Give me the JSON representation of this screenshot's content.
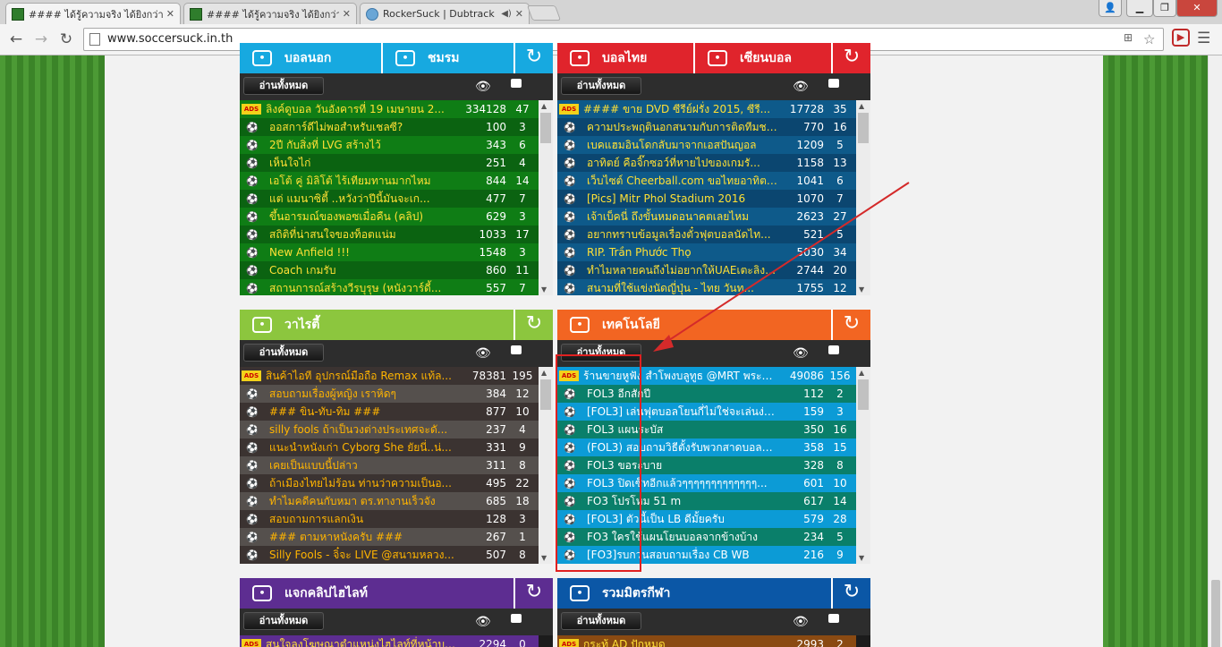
{
  "browser": {
    "tabs": [
      {
        "title": "#### ได้รู้ความจริง ได้ยิงกว่า",
        "icon": "soccersuck-favicon",
        "active": true
      },
      {
        "title": "#### ได้รู้ความจริง ได้ยิงกว่า",
        "icon": "soccersuck-favicon",
        "active": false
      },
      {
        "title": "RockerSuck | Dubtrack",
        "icon": "dubtrack-favicon",
        "active": false
      }
    ],
    "url": "www.soccersuck.in.th",
    "colors": {
      "close": "#c9463d",
      "tabbar": "#d4d4d4"
    }
  },
  "panels": [
    {
      "id": "football-foreign",
      "headers": [
        {
          "label": "บอลนอก",
          "icon": "runner-icon",
          "color": "#17a9e0",
          "w": 158
        },
        {
          "label": "ชมรม",
          "icon": "masks-icon",
          "color": "#17a9e0",
          "w": 148
        }
      ],
      "read_all": "อ่านทั้งหมด",
      "text_color": "#ffe035",
      "row_colors": [
        "#0f7d15",
        "#0b6311"
      ],
      "rows": [
        {
          "ads": true,
          "title": "ลิงค์ดูบอล วันอังคารที่ 19 เมษายน 2...",
          "views": "334128",
          "comments": "47"
        },
        {
          "ads": false,
          "title": "ออสการ์ดีไม่พอสำหรับเชลซี?",
          "views": "100",
          "comments": "3"
        },
        {
          "ads": false,
          "title": "2ปี กับสิ่งที่ LVG สร้างไว้",
          "views": "343",
          "comments": "6"
        },
        {
          "ads": false,
          "title": "เห็นใจไก่",
          "views": "251",
          "comments": "4"
        },
        {
          "ads": false,
          "title": "เอโต้ คู่ มิลิโต้ ไร้เทียมทานมากไหม",
          "views": "844",
          "comments": "14"
        },
        {
          "ads": false,
          "title": "แต่ แมนาซิตี้ ..หวังว่าปีนี้มันจะเก...",
          "views": "477",
          "comments": "7"
        },
        {
          "ads": false,
          "title": "ขึ้นอารมณ์ของพอซเมื่อคืน (คลิป)",
          "views": "629",
          "comments": "3"
        },
        {
          "ads": false,
          "title": "สถิติที่น่าสนใจของท็อตแน่ม",
          "views": "1033",
          "comments": "17"
        },
        {
          "ads": false,
          "title": "New Anfield !!!",
          "views": "1548",
          "comments": "3"
        },
        {
          "ads": false,
          "title": "Coach เกมรับ",
          "views": "860",
          "comments": "11"
        },
        {
          "ads": false,
          "title": "สถานการณ์สร้างวีรบุรุษ (หนังวาร์ดี้...",
          "views": "557",
          "comments": "7"
        }
      ]
    },
    {
      "id": "football-thai",
      "headers": [
        {
          "label": "บอลไทย",
          "icon": "kicker-icon",
          "color": "#e0242c",
          "w": 152
        },
        {
          "label": "เซียนบอล",
          "icon": "player-icon",
          "color": "#e0242c",
          "w": 154
        }
      ],
      "read_all": "อ่านทั้งหมด",
      "text_color": "#ffe035",
      "row_colors": [
        "#0e5a8a",
        "#0b4670"
      ],
      "rows": [
        {
          "ads": true,
          "title": "#### ขาย DVD ซีรีย์ฝรั่ง 2015, ซีรี...",
          "views": "17728",
          "comments": "35"
        },
        {
          "ads": false,
          "title": "ความประพฤตินอกสนามกับการติดทีมชาติไ...",
          "views": "770",
          "comments": "16"
        },
        {
          "ads": false,
          "title": "เบคแฮมอินโดกลับมาจากเอสปันญอล",
          "views": "1209",
          "comments": "5"
        },
        {
          "ads": false,
          "title": "อาทิตย์ คือจิ๊กซอว์ที่หายไปของเกมรั...",
          "views": "1158",
          "comments": "13"
        },
        {
          "ads": false,
          "title": "เว็บไซต์ Cheerball.com ขอไทยอาทิตย์...",
          "views": "1041",
          "comments": "6"
        },
        {
          "ads": false,
          "title": "[Pics] Mitr Phol Stadium 2016",
          "views": "1070",
          "comments": "7"
        },
        {
          "ads": false,
          "title": "เจ้าเบ็คนี่ ถึงขั้นหมดอนาคตเลยไหม",
          "views": "2623",
          "comments": "27"
        },
        {
          "ads": false,
          "title": "อยากทราบข้อมูลเรื่องตั๋วฟุตบอลนัดไท...",
          "views": "521",
          "comments": "5"
        },
        {
          "ads": false,
          "title": "RIP. Trần Phước Thọ",
          "views": "5030",
          "comments": "34"
        },
        {
          "ads": false,
          "title": "ทำไมหลายคนถึงไม่อยากให้UAEเตะลิงส์ค...",
          "views": "2744",
          "comments": "20"
        },
        {
          "ads": false,
          "title": "สนามที่ใช้แข่งนัดญี่ปุ่น - ไทย วันท...",
          "views": "1755",
          "comments": "12"
        }
      ]
    },
    {
      "id": "variety",
      "headers": [
        {
          "label": "วาไรตี้",
          "icon": "masks-icon",
          "color": "#8cc63e",
          "w": 306
        }
      ],
      "read_all": "อ่านทั้งหมด",
      "text_color": "#ffb400",
      "row_colors": [
        "#3b3331",
        "#55504d"
      ],
      "rows": [
        {
          "ads": true,
          "title": "สินค้าไอที อุปกรณ์มือถือ Remax แท้ล...",
          "views": "78381",
          "comments": "195"
        },
        {
          "ads": false,
          "title": "สอบถามเรื่องผู้หญิง เราหิดๆ",
          "views": "384",
          "comments": "12"
        },
        {
          "ads": false,
          "title": "### ขิน-ทับ-ทิม ###",
          "views": "877",
          "comments": "10"
        },
        {
          "ads": false,
          "title": "silly fools ถ้าเป็นวงต่างประเทศจะดั...",
          "views": "237",
          "comments": "4"
        },
        {
          "ads": false,
          "title": "แนะนำหนังเก่า Cyborg She ยัยนี่..น่...",
          "views": "331",
          "comments": "9"
        },
        {
          "ads": false,
          "title": "เคยเป็นแบบนี้ปล่าว",
          "views": "311",
          "comments": "8"
        },
        {
          "ads": false,
          "title": "ถ้าเมืองไทยไม่ร้อน ท่านว่าความเป็นอ...",
          "views": "495",
          "comments": "22"
        },
        {
          "ads": false,
          "title": "ทำไมคดีคนกับหมา ตร.ทางานเร็วจัง",
          "views": "685",
          "comments": "18"
        },
        {
          "ads": false,
          "title": "สอบถามการแลกเงิน",
          "views": "128",
          "comments": "3"
        },
        {
          "ads": false,
          "title": "### ตามหาหนังครับ ###",
          "views": "267",
          "comments": "1"
        },
        {
          "ads": false,
          "title": "Silly Fools - จิ๋จะ LIVE @สนามหลวง...",
          "views": "507",
          "comments": "8"
        }
      ]
    },
    {
      "id": "technology",
      "headers": [
        {
          "label": "เทคโนโลยี",
          "icon": "chip-icon",
          "color": "#f26522",
          "w": 306
        }
      ],
      "read_all": "อ่านทั้งหมด",
      "text_color": "#ffffff",
      "row_colors": [
        "#0c9bd6",
        "#0a7f6a"
      ],
      "rows": [
        {
          "ads": true,
          "title": "ร้านขายหูฟัง สำโพงบลูทูธ @MRT พระรา...",
          "views": "49086",
          "comments": "156"
        },
        {
          "ads": false,
          "title": "FOL3 อีกสักปี",
          "views": "112",
          "comments": "2"
        },
        {
          "ads": false,
          "title": "[FOL3] เล่นฟุตบอลโยนกี่ไม่ใช่จะเล่นง่าย...",
          "views": "159",
          "comments": "3"
        },
        {
          "ads": false,
          "title": "FOL3 แผนระบัส",
          "views": "350",
          "comments": "16"
        },
        {
          "ads": false,
          "title": "(FOL3) สอบถามวิธีตั้งรับพวกสาดบอลยา...",
          "views": "358",
          "comments": "15"
        },
        {
          "ads": false,
          "title": "FOL3 ขอระบาย",
          "views": "328",
          "comments": "8"
        },
        {
          "ads": false,
          "title": "FOL3 ปิดเซ็ทอีกแล้วๆๆๆๆๆๆๆๆๆๆๆๆๆ...",
          "views": "601",
          "comments": "10"
        },
        {
          "ads": false,
          "title": "FO3 โปรโหม 51 m",
          "views": "617",
          "comments": "14"
        },
        {
          "ads": false,
          "title": "[FOL3] ตัวนี้เป็น LB ดีมั้ยครับ",
          "views": "579",
          "comments": "28"
        },
        {
          "ads": false,
          "title": "FO3 ใครใช้แผนโยนบอลจากข้างบ้าง",
          "views": "234",
          "comments": "5"
        },
        {
          "ads": false,
          "title": "[FO3]รบกวนสอบถามเรื่อง CB WB",
          "views": "216",
          "comments": "9"
        }
      ]
    },
    {
      "id": "clips",
      "headers": [
        {
          "label": "แจกคลิปไฮไลท์",
          "icon": "play-icon",
          "color": "#5d2d91",
          "w": 306
        }
      ],
      "read_all": "อ่านทั้งหมด",
      "text_color": "#ffe035",
      "row_colors": [
        "#5d2d91",
        "#4a2274"
      ],
      "rows": [
        {
          "ads": true,
          "title": "สนใจลงโฆษณาตำแหน่งไฮไลท์ที่หน้าบร...",
          "views": "2294",
          "comments": "0"
        }
      ]
    },
    {
      "id": "sports-allies",
      "headers": [
        {
          "label": "รวมมิตรกีฬา",
          "icon": "athlete-icon",
          "color": "#0b57a6",
          "w": 306
        }
      ],
      "read_all": "อ่านทั้งหมด",
      "text_color": "#ffe035",
      "row_colors": [
        "#8a4a12",
        "#6e3a0e"
      ],
      "rows": [
        {
          "ads": true,
          "title": "กระทู้ AD ปักหมุด",
          "views": "2993",
          "comments": "2"
        }
      ]
    }
  ]
}
